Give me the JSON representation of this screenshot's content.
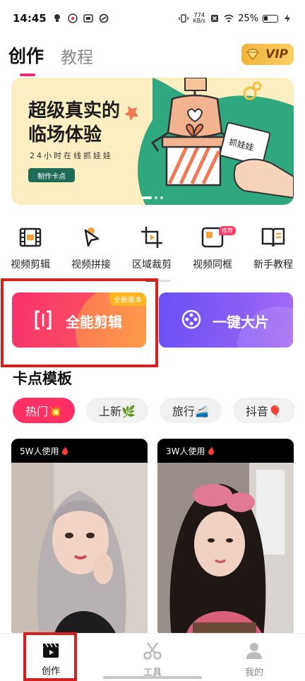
{
  "status_bar": {
    "time": "14:45",
    "net_speed_value": "774",
    "net_speed_unit": "KB/s",
    "battery": "25%"
  },
  "header": {
    "tabs": [
      {
        "label": "创作",
        "active": true
      },
      {
        "label": "教程",
        "active": false
      }
    ],
    "vip_label": "VIP"
  },
  "banner": {
    "title_line1": "超级真实的",
    "title_line2": "临场体验",
    "subtitle": "24小时在线抓娃娃",
    "button_label": "制作卡点",
    "card_text": "抓娃娃",
    "pages": 3,
    "active_page": 0
  },
  "tools": [
    {
      "label": "视频剪辑",
      "icon": "film-icon"
    },
    {
      "label": "视频拼接",
      "icon": "play-cursor-icon"
    },
    {
      "label": "区域裁剪",
      "icon": "crop-icon"
    },
    {
      "label": "视频同框",
      "icon": "split-frame-icon",
      "badge": "推荐"
    },
    {
      "label": "新手教程",
      "icon": "book-icon"
    }
  ],
  "actions": {
    "edit": {
      "label": "全能剪辑",
      "tag": "全新版本"
    },
    "auto": {
      "label": "一键大片"
    }
  },
  "templates": {
    "title": "卡点模板",
    "chips": [
      {
        "label": "热门💥",
        "active": true
      },
      {
        "label": "上新🌿",
        "active": false
      },
      {
        "label": "旅行🚄",
        "active": false
      },
      {
        "label": "抖音🎈",
        "active": false
      }
    ],
    "cards": [
      {
        "usage": "5W人使用"
      },
      {
        "usage": "3W人使用"
      }
    ]
  },
  "bottom_nav": [
    {
      "label": "创作",
      "icon": "clapperboard-icon",
      "active": true
    },
    {
      "label": "工具",
      "icon": "scissors-icon",
      "active": false
    },
    {
      "label": "我的",
      "icon": "user-icon",
      "active": false
    }
  ],
  "colors": {
    "accent": "#ff2f63",
    "highlight_border": "#d42020",
    "vip_gold": "#f2b43a",
    "auto_card": "#7b56f5"
  }
}
